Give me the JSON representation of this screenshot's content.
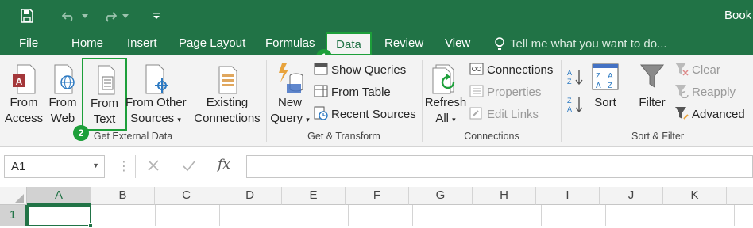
{
  "window": {
    "title": "Book"
  },
  "tabs": [
    {
      "label": "File"
    },
    {
      "label": "Home"
    },
    {
      "label": "Insert"
    },
    {
      "label": "Page Layout"
    },
    {
      "label": "Formulas"
    },
    {
      "label": "Data"
    },
    {
      "label": "Review"
    },
    {
      "label": "View"
    }
  ],
  "tell_me": "Tell me what you want to do...",
  "callouts": {
    "one": "1",
    "two": "2"
  },
  "groups": {
    "external": {
      "label": "Get External Data",
      "from_access": [
        "From",
        "Access"
      ],
      "from_web": [
        "From",
        "Web"
      ],
      "from_text": [
        "From",
        "Text"
      ],
      "from_other": [
        "From Other",
        "Sources"
      ]
    },
    "existing": [
      "Existing",
      "Connections"
    ],
    "transform": {
      "label": "Get & Transform",
      "new_query": [
        "New",
        "Query"
      ],
      "show_queries": "Show Queries",
      "from_table": "From Table",
      "recent_sources": "Recent Sources"
    },
    "connections": {
      "label": "Connections",
      "refresh_all": [
        "Refresh",
        "All"
      ],
      "connections": "Connections",
      "properties": "Properties",
      "edit_links": "Edit Links"
    },
    "sortfilter": {
      "label": "Sort & Filter",
      "sort": "Sort",
      "filter": "Filter",
      "clear": "Clear",
      "reapply": "Reapply",
      "advanced": "Advanced"
    }
  },
  "formula_bar": {
    "name_box": "A1",
    "fx": "fx",
    "value": ""
  },
  "columns": [
    "A",
    "B",
    "C",
    "D",
    "E",
    "F",
    "G",
    "H",
    "I",
    "J",
    "K"
  ],
  "rows": [
    "1"
  ],
  "colors": {
    "excel_green": "#217346",
    "callout_green": "#1d9f3a"
  }
}
